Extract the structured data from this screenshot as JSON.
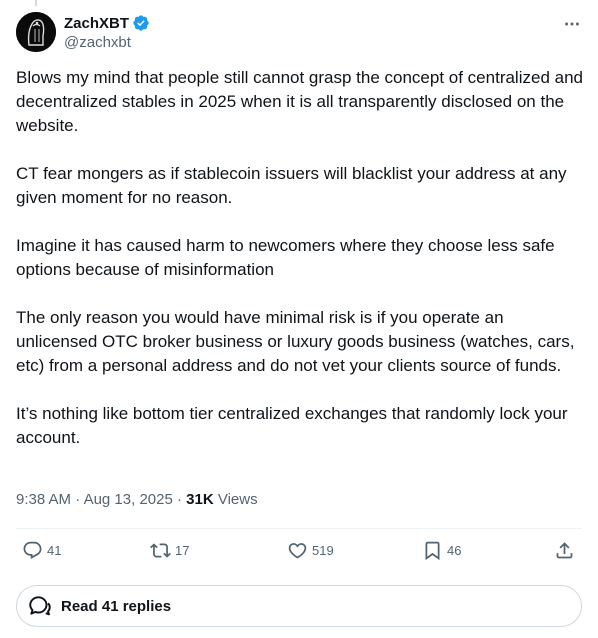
{
  "author": {
    "display_name": "ZachXBT",
    "handle": "@zachxbt",
    "verified": true
  },
  "tweet": {
    "paragraphs": [
      "Blows my mind that people still cannot grasp the concept of centralized and decentralized stables in 2025 when it is all transparently disclosed on the website.",
      "CT fear mongers as if stablecoin issuers will blacklist your address at any given moment for no reason.",
      "Imagine it has caused harm to newcomers where they choose less safe options because of misinformation",
      "The only reason you would have minimal risk is if you operate an unlicensed OTC broker business or luxury goods business (watches, cars, etc) from a personal address and do not vet your clients source of funds.",
      "It’s nothing like bottom tier centralized exchanges that randomly lock your account."
    ],
    "time": "9:38 AM",
    "date": "Aug 13, 2025",
    "views_count": "31K",
    "views_label": "Views"
  },
  "actions": {
    "replies": "41",
    "reposts": "17",
    "likes": "519",
    "bookmarks": "46"
  },
  "read_replies": {
    "label": "Read 41 replies"
  },
  "colors": {
    "text": "#0f1419",
    "secondary": "#536471",
    "verified": "#1d9bf0",
    "border": "#cfd9de"
  },
  "icons": [
    "verified-badge-icon",
    "more-icon",
    "reply-icon",
    "repost-icon",
    "like-icon",
    "bookmark-icon",
    "share-icon",
    "speech-bubbles-icon"
  ]
}
